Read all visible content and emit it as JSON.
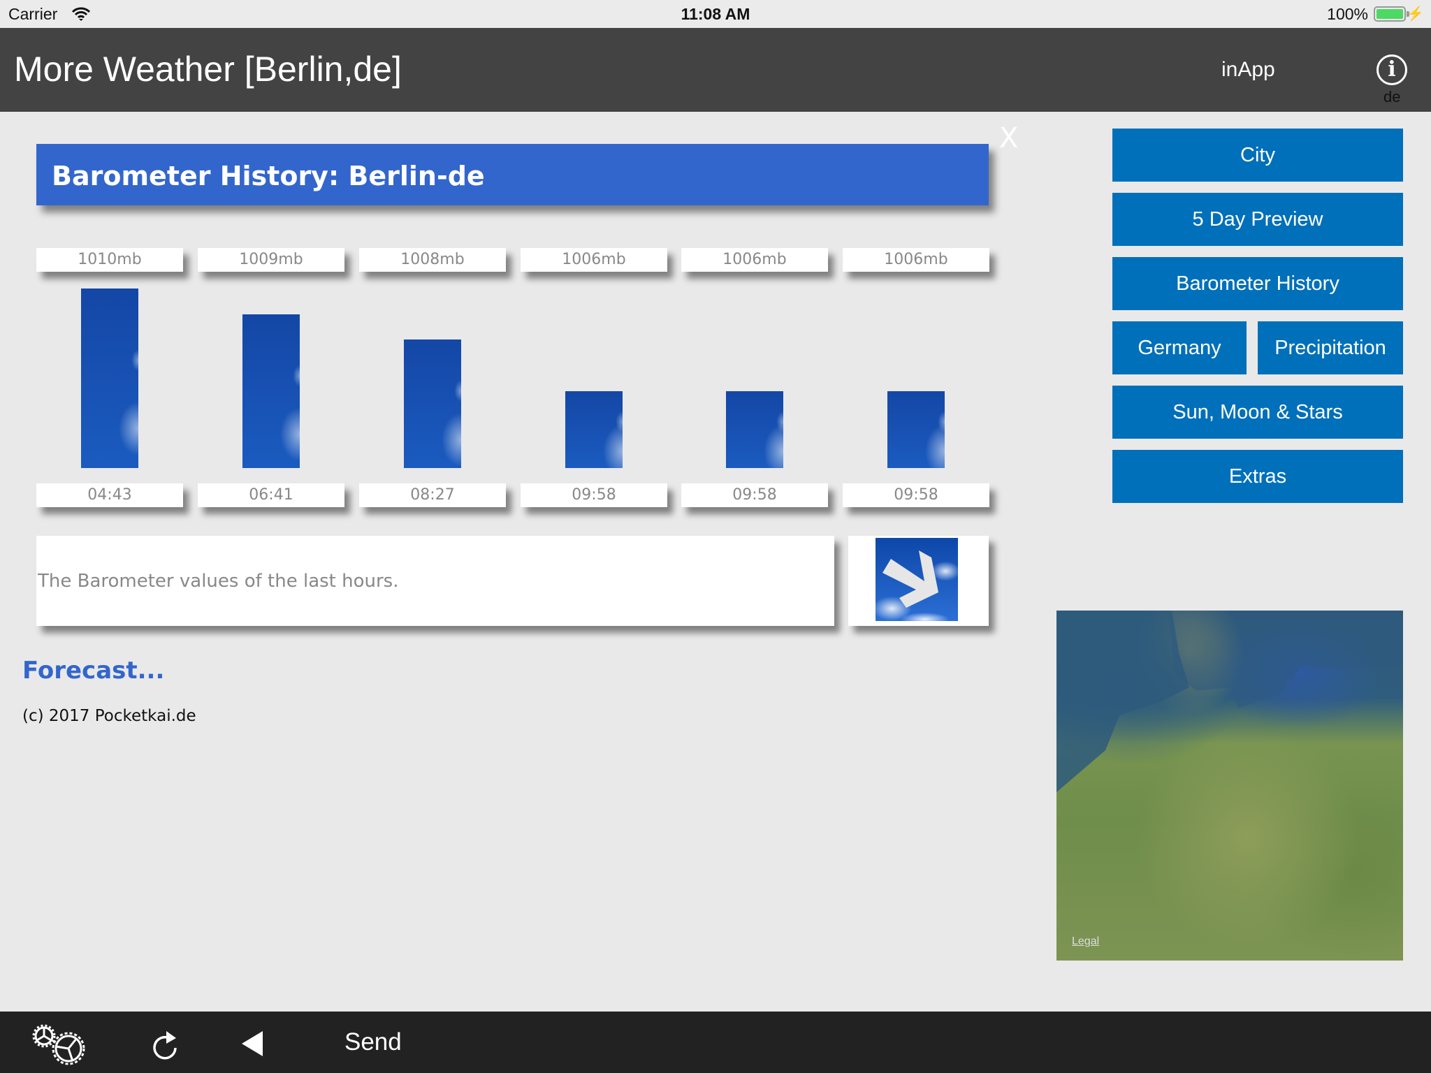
{
  "status_bar": {
    "carrier": "Carrier",
    "time": "11:08 AM",
    "battery": "100%",
    "icons": [
      "wifi-icon",
      "battery-icon",
      "charging-bolt-icon"
    ]
  },
  "header": {
    "title": "More Weather [Berlin,de]",
    "inapp_label": "inApp",
    "info_icon": "i",
    "language": "de"
  },
  "panel": {
    "title": "Barometer History: Berlin-de",
    "close_label": "X",
    "description": "The Barometer values of the last hours.",
    "trend_icon": "arrow-down-right-icon",
    "forecast_link": "Forecast...",
    "copyright": "(c) 2017 Pocketkai.de"
  },
  "chart_data": {
    "type": "bar",
    "title": "Barometer History: Berlin-de",
    "xlabel": "",
    "ylabel": "mb",
    "categories": [
      "04:43",
      "06:41",
      "08:27",
      "09:58",
      "09:58",
      "09:58"
    ],
    "values": [
      1010,
      1009,
      1008,
      1006,
      1006,
      1006
    ],
    "value_labels": [
      "1010mb",
      "1009mb",
      "1008mb",
      "1006mb",
      "1006mb",
      "1006mb"
    ],
    "ylim": [
      1003,
      1010
    ]
  },
  "menu": {
    "buttons": [
      {
        "label": "City"
      },
      {
        "label": "5 Day Preview"
      },
      {
        "label": "Barometer History"
      },
      {
        "label": "Germany"
      },
      {
        "label": "Precipitation"
      },
      {
        "label": "Sun, Moon & Stars"
      },
      {
        "label": "Extras"
      }
    ]
  },
  "map": {
    "legal_label": "Legal"
  },
  "toolbar": {
    "settings_icon": "gears-icon",
    "reload_icon": "reload-icon",
    "back_icon": "back-triangle-icon",
    "send_label": "Send"
  }
}
